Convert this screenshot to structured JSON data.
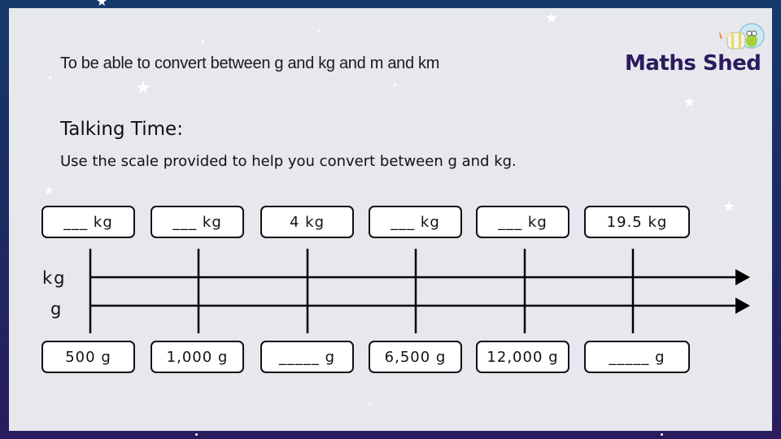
{
  "slide": {
    "objective": "To be able to convert between g and kg and m and km",
    "logo_text": "Maths Shed",
    "heading": "Talking Time:",
    "instruction": "Use the scale provided to help you convert between g and kg."
  },
  "scale": {
    "top_unit_label": "kg",
    "bottom_unit_label": "g",
    "kg_boxes": [
      "___ kg",
      "___ kg",
      "4 kg",
      "___ kg",
      "___ kg",
      "19.5 kg"
    ],
    "g_boxes": [
      "500 g",
      "1,000 g",
      "_____ g",
      "6,500 g",
      "12,000 g",
      "_____ g"
    ],
    "tick_count": 6
  },
  "colors": {
    "background_top": "#153a6b",
    "background_bottom": "#2a1b5e",
    "panel": "#e6e8ee",
    "logo": "#2c1a5c",
    "ink": "#111111"
  }
}
